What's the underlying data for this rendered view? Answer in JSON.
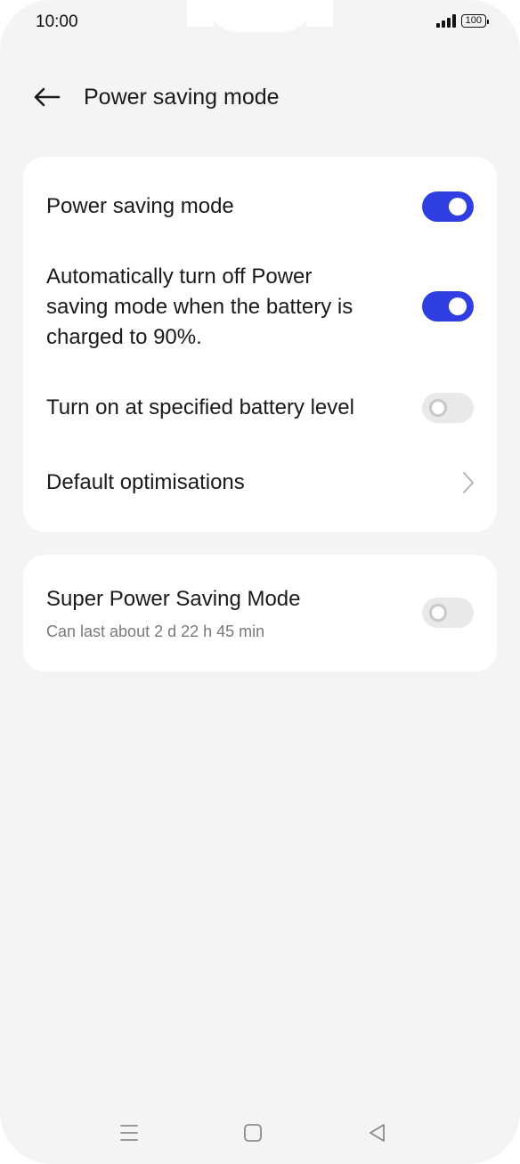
{
  "status_bar": {
    "time": "10:00",
    "battery": "100"
  },
  "header": {
    "title": "Power saving mode"
  },
  "settings": {
    "power_saving": {
      "label": "Power saving mode",
      "enabled": true
    },
    "auto_off": {
      "line1": "Automatically turn off Power",
      "line2": "saving mode when the battery is",
      "line3": "charged to 90%.",
      "enabled": true
    },
    "specified_level": {
      "label": "Turn on at specified battery level",
      "enabled": false
    },
    "default_optimisations": {
      "label": "Default optimisations"
    }
  },
  "super_saving": {
    "label": "Super Power Saving Mode",
    "subtext": "Can last about 2 d 22 h 45 min",
    "enabled": false
  },
  "icons": [
    "back-arrow-icon",
    "chevron-right-icon",
    "signal-icon",
    "battery-icon",
    "menu-icon",
    "home-icon",
    "back-triangle-icon"
  ]
}
